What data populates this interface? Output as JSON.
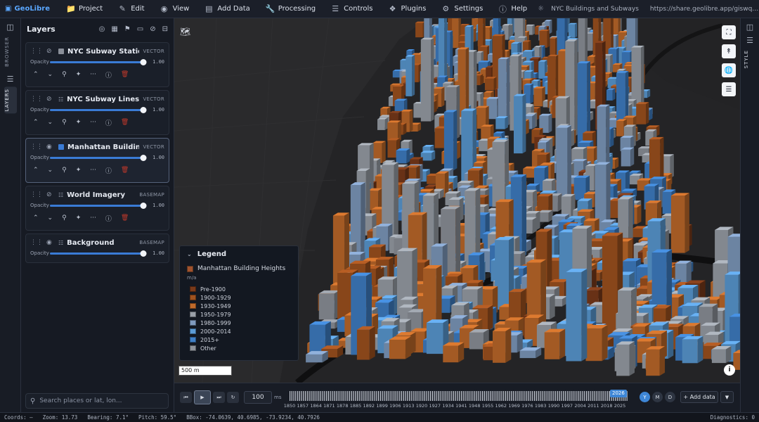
{
  "app": {
    "brand": "GeoLibre",
    "menu": [
      {
        "label": "Project",
        "icon": "folder-icon"
      },
      {
        "label": "Edit",
        "icon": "pencil-icon"
      },
      {
        "label": "View",
        "icon": "eye-icon"
      },
      {
        "label": "Add Data",
        "icon": "database-icon"
      },
      {
        "label": "Processing",
        "icon": "wrench-icon"
      },
      {
        "label": "Controls",
        "icon": "sliders-icon"
      },
      {
        "label": "Plugins",
        "icon": "puzzle-icon"
      },
      {
        "label": "Settings",
        "icon": "gear-icon"
      },
      {
        "label": "Help",
        "icon": "help-icon"
      }
    ],
    "project_title": "NYC Buildings and Subways",
    "share_url": "https://share.geolibre.app/giswqs/nyc-buildings-and-subways.geolibre.j..."
  },
  "left_rail": {
    "tabs": [
      "BROWSER",
      "LAYERS"
    ],
    "active": "LAYERS"
  },
  "layers_panel": {
    "title": "Layers",
    "opacity_label": "Opacity",
    "layers": [
      {
        "name": "NYC Subway Stations (MTA)",
        "type": "VECTOR",
        "opacity": "1.00",
        "visible": false,
        "swatch": "#8a8f99"
      },
      {
        "name": "NYC Subway Lines (MTA)",
        "type": "VECTOR",
        "opacity": "1.00",
        "visible": false,
        "swatch": ""
      },
      {
        "name": "Manhattan Building Heights",
        "type": "VECTOR",
        "opacity": "1.00",
        "visible": true,
        "swatch": "#3a7bd5"
      },
      {
        "name": "World Imagery",
        "type": "BASEMAP",
        "opacity": "1.00",
        "visible": false,
        "swatch": ""
      },
      {
        "name": "Background",
        "type": "BASEMAP",
        "opacity": "1.00",
        "visible": true,
        "swatch": ""
      }
    ],
    "search_placeholder": "Search places or lat, lon..."
  },
  "right_rail": {
    "tab": "STYLE"
  },
  "legend": {
    "title": "Legend",
    "layer": "Manhattan Building Heights",
    "unit": "m/a",
    "items": [
      {
        "label": "Pre-1900",
        "color": "#7a3a1a"
      },
      {
        "label": "1900-1929",
        "color": "#a0521f"
      },
      {
        "label": "1930-1949",
        "color": "#c06a2a"
      },
      {
        "label": "1950-1979",
        "color": "#9aa0a8"
      },
      {
        "label": "1980-1999",
        "color": "#7f9bbf"
      },
      {
        "label": "2000-2014",
        "color": "#5b9bd5"
      },
      {
        "label": "2015+",
        "color": "#3f7fc6"
      },
      {
        "label": "Other",
        "color": "#8e939b"
      }
    ]
  },
  "map": {
    "scale_label": "500 m"
  },
  "timeline": {
    "speed": "100",
    "speed_unit": "ms",
    "current_year": "2026",
    "years": [
      "1850",
      "1857",
      "1864",
      "1871",
      "1878",
      "1885",
      "1892",
      "1899",
      "1906",
      "1913",
      "1920",
      "1927",
      "1934",
      "1941",
      "1948",
      "1955",
      "1962",
      "1969",
      "1976",
      "1983",
      "1990",
      "1997",
      "2004",
      "2011",
      "2018",
      "2025"
    ],
    "modes": [
      "Y",
      "M",
      "D"
    ],
    "active_mode": "Y",
    "add_data_label": "+ Add data"
  },
  "status": {
    "coords": "Coords: —",
    "zoom": "Zoom: 13.73",
    "bearing": "Bearing: 7.1°",
    "pitch": "Pitch: 59.5°",
    "bbox": "BBox: -74.0639, 40.6985, -73.9234, 40.7926",
    "diagnostics": "Diagnostics: 0"
  },
  "colors": {
    "accent": "#3a7bd5",
    "orange": "#c06a2a",
    "blue": "#5b9bd5"
  }
}
